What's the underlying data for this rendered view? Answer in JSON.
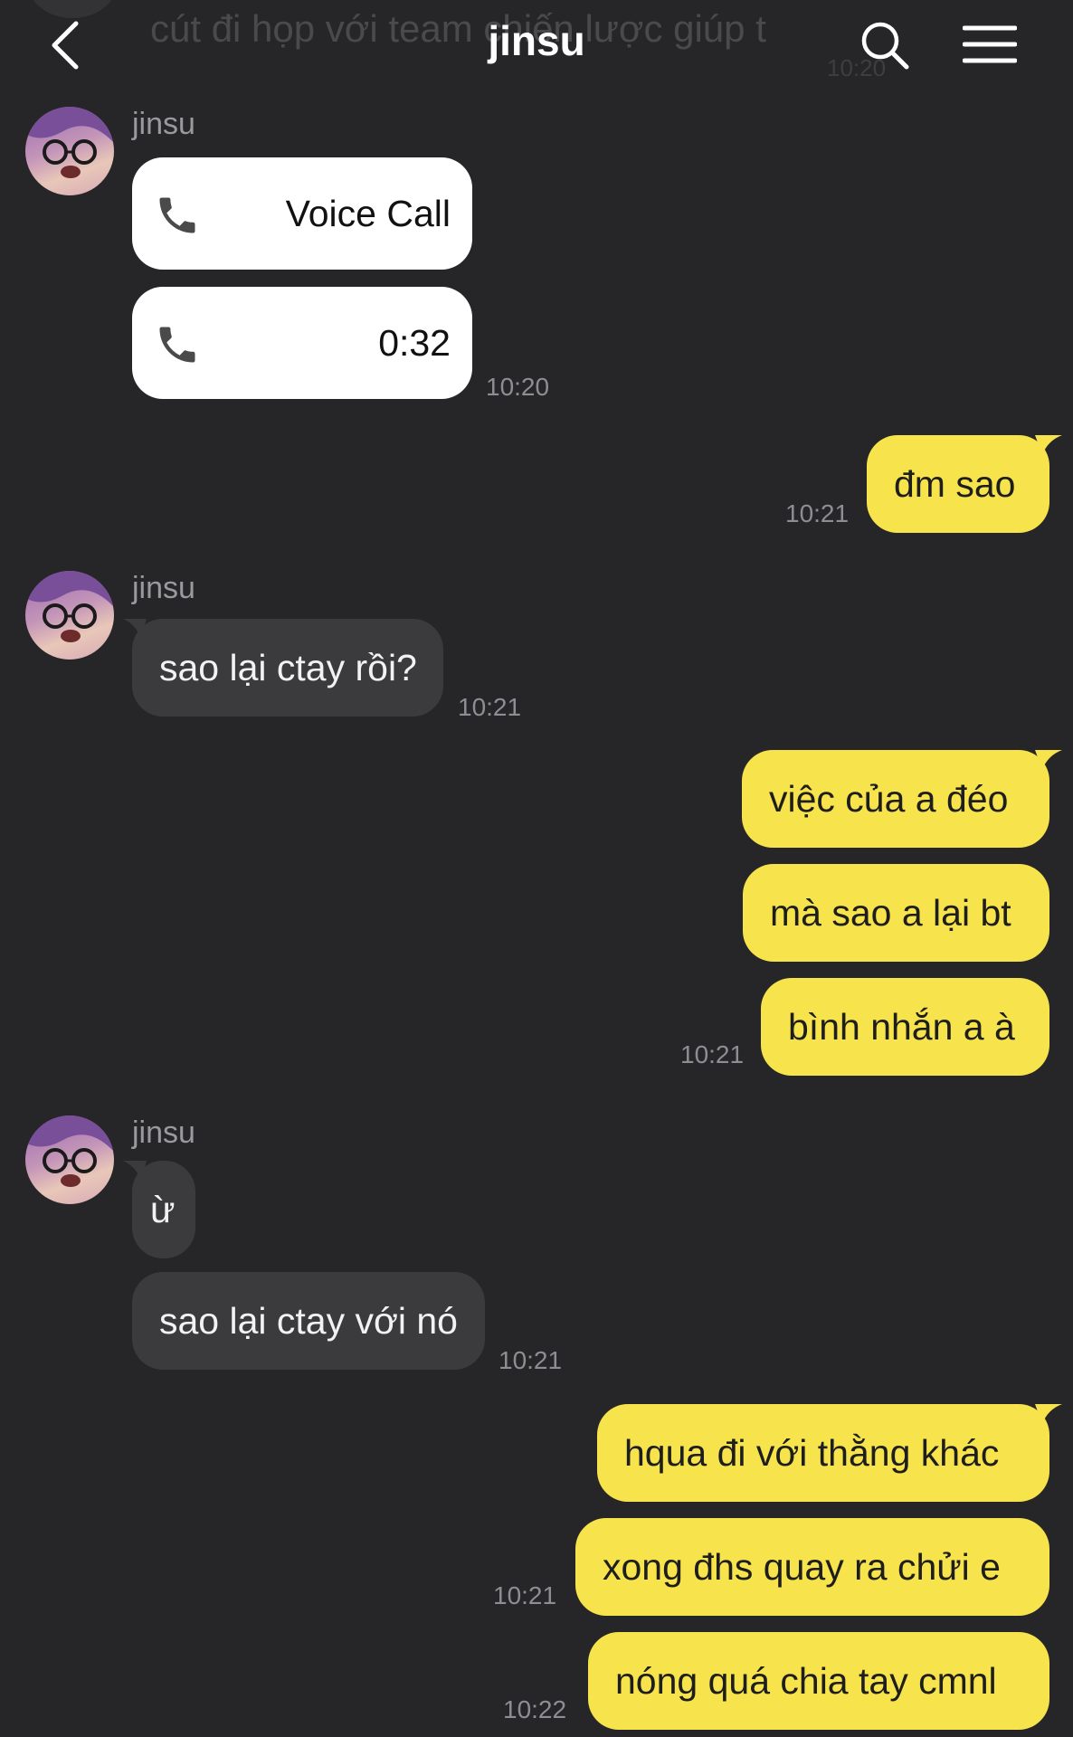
{
  "header": {
    "title": "jinsu",
    "ghost_preview": "cút đi họp với team chiến lược giúp t",
    "ghost_time": "10:20"
  },
  "messages": {
    "sender_name": "jinsu",
    "call1_label": "Voice Call",
    "call2_label": "0:32",
    "call_time": "10:20",
    "m1": "đm sao",
    "m1_time": "10:21",
    "m2": "sao lại ctay rồi?",
    "m2_time": "10:21",
    "m3": "việc của a đéo",
    "m4": "mà sao a lại bt",
    "m5": "bình nhắn a à",
    "m3_time": "10:21",
    "m6": "ừ",
    "m7": "sao lại ctay với nó",
    "m7_time": "10:21",
    "m8": "hqua đi với thằng khác",
    "m9": "xong đhs quay ra chửi e",
    "m9_time": "10:21",
    "m10": "nóng quá chia tay cmnl",
    "m10_time": "10:22"
  },
  "colors": {
    "background": "#262628",
    "outgoing_bubble": "#f7e34b",
    "incoming_bubble": "#3b3b3d",
    "call_bubble": "#ffffff"
  },
  "icons": [
    "back-icon",
    "search-icon",
    "menu-icon",
    "phone-icon",
    "avatar"
  ]
}
